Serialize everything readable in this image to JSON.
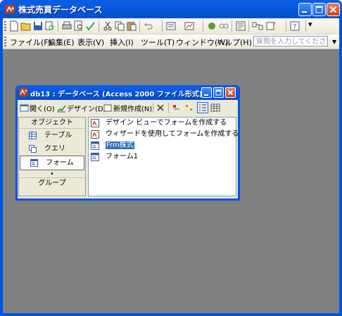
{
  "app": {
    "title": "株式売買データベース",
    "menu": [
      {
        "label": "ファイル(F)"
      },
      {
        "label": "編集(E)"
      },
      {
        "label": "表示(V)"
      },
      {
        "label": "挿入(I)"
      },
      {
        "label": "ツール(T)"
      },
      {
        "label": "ウィンドウ(W)"
      },
      {
        "label": "ヘルプ(H)"
      }
    ],
    "help_placeholder": "質問を入力してください"
  },
  "db_window": {
    "title": "db13 : データベース (Access 2000 ファイル形式)",
    "toolbar": {
      "open": "開く(O)",
      "design": "デザイン(D)",
      "new": "新規作成(N)"
    },
    "objects_header": "オブジェクト",
    "objects": [
      {
        "label": "テーブル",
        "icon": "table-icon"
      },
      {
        "label": "クエリ",
        "icon": "query-icon"
      },
      {
        "label": "フォーム",
        "icon": "form-icon",
        "selected": true
      }
    ],
    "groups_label": "グループ",
    "items": [
      {
        "label": "デザイン ビューでフォームを作成する",
        "icon": "design-wizard-icon"
      },
      {
        "label": "ウィザードを使用してフォームを作成する",
        "icon": "wizard-icon"
      },
      {
        "label": "Frm株式",
        "icon": "form-icon",
        "selected": true
      },
      {
        "label": "フォーム1",
        "icon": "form-icon"
      }
    ]
  },
  "colors": {
    "title_bar": "#0054e3",
    "workspace": "#808080",
    "selection": "#316ac5",
    "face": "#ece9d8"
  }
}
